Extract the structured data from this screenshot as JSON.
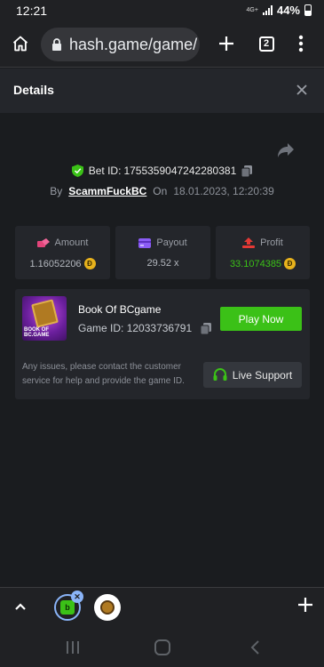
{
  "status_bar": {
    "time": "12:21",
    "network": "4G+",
    "battery": "44%"
  },
  "browser": {
    "url": "hash.game/game/",
    "tab_count": "2"
  },
  "details": {
    "title": "Details",
    "bet_id_label": "Bet ID:",
    "bet_id": "1755359047242280381",
    "by_label": "By",
    "username": "ScammFuckBC",
    "on_label": "On",
    "date": "18.01.2023, 12:20:39"
  },
  "stats": [
    {
      "label": "Amount",
      "value": "1.16052206",
      "icon": "amount-icon",
      "color": "#e2447a"
    },
    {
      "label": "Payout",
      "value": "29.52 x",
      "icon": "payout-icon",
      "color": "#8b5cf6"
    },
    {
      "label": "Profit",
      "value": "33.1074385",
      "icon": "profit-icon",
      "color": "#e53935"
    }
  ],
  "game": {
    "name": "Book Of BCgame",
    "id_label": "Game ID:",
    "id": "12033736791",
    "thumb_text": "BOOK OF BC.GAME",
    "play_label": "Play Now",
    "support_text": "Any issues, please contact the customer service for help and provide the game ID.",
    "support_label": "Live Support"
  },
  "colors": {
    "accent_green": "#3bc117",
    "coin": "#e8b21c",
    "background": "#1a1c1f",
    "panel": "#24262b"
  }
}
